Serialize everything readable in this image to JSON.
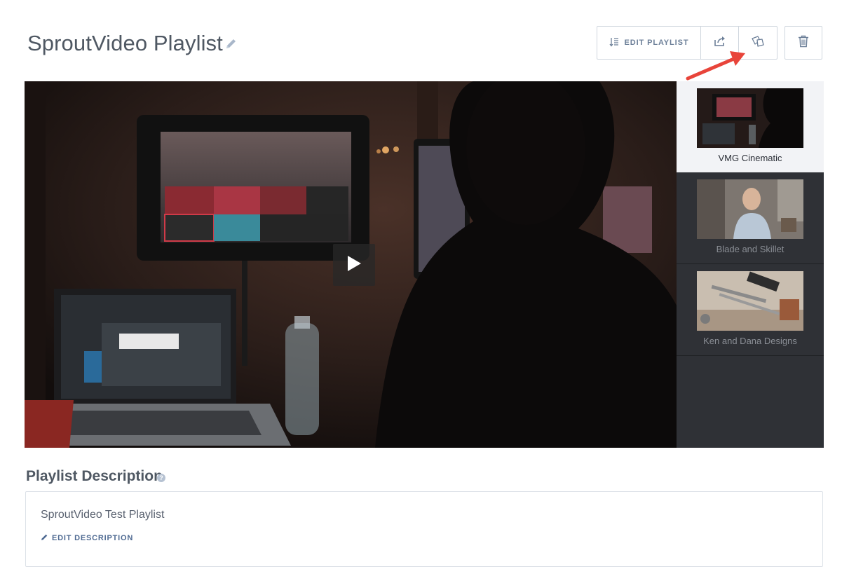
{
  "page": {
    "title": "SproutVideo Playlist",
    "edit_title_icon": "pencil-icon"
  },
  "toolbar": {
    "edit_playlist_label": "EDIT PLAYLIST",
    "edit_playlist_icon": "sort-list-icon",
    "share_icon": "share-icon",
    "embed_icon": "embed-cards-icon",
    "delete_icon": "trash-icon"
  },
  "annotation": {
    "arrow_color": "#e8443a"
  },
  "player": {
    "play_icon": "play-icon",
    "playlist": [
      {
        "label": "VMG Cinematic",
        "active": true
      },
      {
        "label": "Blade and Skillet",
        "active": false
      },
      {
        "label": "Ken and Dana Designs",
        "active": false
      }
    ]
  },
  "description": {
    "heading": "Playlist Description",
    "help_icon": "question-icon",
    "text": "SproutVideo Test Playlist",
    "edit_label": "EDIT DESCRIPTION",
    "edit_icon": "pencil-icon"
  },
  "colors": {
    "accent": "#4f6a92",
    "sidebar_bg": "#2f3136",
    "active_item_bg": "#f2f3f6"
  }
}
